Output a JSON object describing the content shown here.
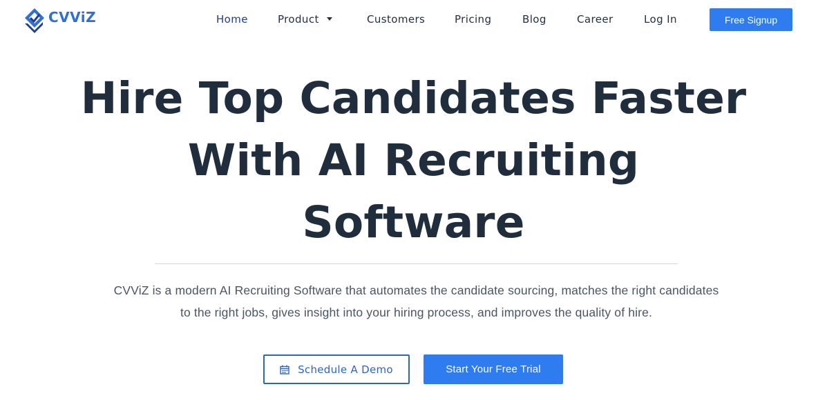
{
  "brand": {
    "name": "CVViZ",
    "colors": {
      "primary": "#2f7bf0",
      "outline": "#2d63c7",
      "heading": "#1f2d3d",
      "nav_active": "#1f3b8f"
    }
  },
  "nav": {
    "items": [
      {
        "label": "Home",
        "active": true
      },
      {
        "label": "Product",
        "has_dropdown": true,
        "icon": "caret-down-icon"
      },
      {
        "label": "Customers"
      },
      {
        "label": "Pricing"
      },
      {
        "label": "Blog"
      },
      {
        "label": "Career"
      },
      {
        "label": "Log In"
      }
    ],
    "cta_label": "Free Signup"
  },
  "hero": {
    "headline_lines": [
      "Hire Top Candidates Faster",
      "With AI Recruiting",
      "Software"
    ],
    "description_lines": [
      "CVViZ is a modern AI Recruiting Software that automates the candidate sourcing, matches the right candidates",
      "to the right jobs, gives insight into your hiring process, and improves the quality of hire."
    ],
    "demo_button": {
      "label": "Schedule A Demo",
      "icon": "calendar-icon"
    },
    "trial_button": {
      "label": "Start Your Free Trial"
    }
  }
}
